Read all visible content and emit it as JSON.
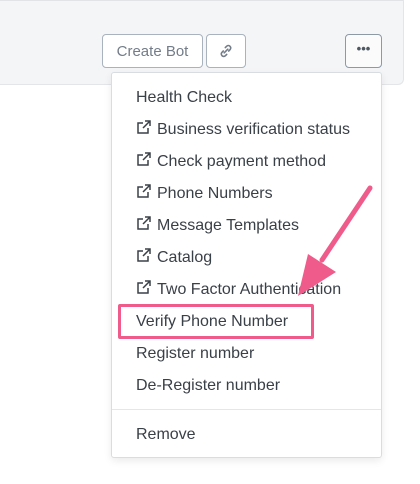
{
  "top_fragment": "...",
  "toolbar": {
    "create_bot_label": "Create Bot"
  },
  "menu": {
    "items": [
      {
        "label": "Health Check",
        "external": false
      },
      {
        "label": "Business verification status",
        "external": true
      },
      {
        "label": "Check payment method",
        "external": true
      },
      {
        "label": "Phone Numbers",
        "external": true
      },
      {
        "label": "Message Templates",
        "external": true
      },
      {
        "label": "Catalog",
        "external": true
      },
      {
        "label": "Two Factor Authentication",
        "external": true
      },
      {
        "label": "Verify Phone Number",
        "external": false
      },
      {
        "label": "Register number",
        "external": false
      },
      {
        "label": "De-Register number",
        "external": false
      }
    ],
    "remove_label": "Remove"
  },
  "annotation": {
    "highlight_color": "#ef5b8a",
    "highlighted_item": "Verify Phone Number"
  },
  "icons": {
    "link": "link-icon",
    "more": "more-horizontal-icon",
    "external": "external-link-icon"
  }
}
